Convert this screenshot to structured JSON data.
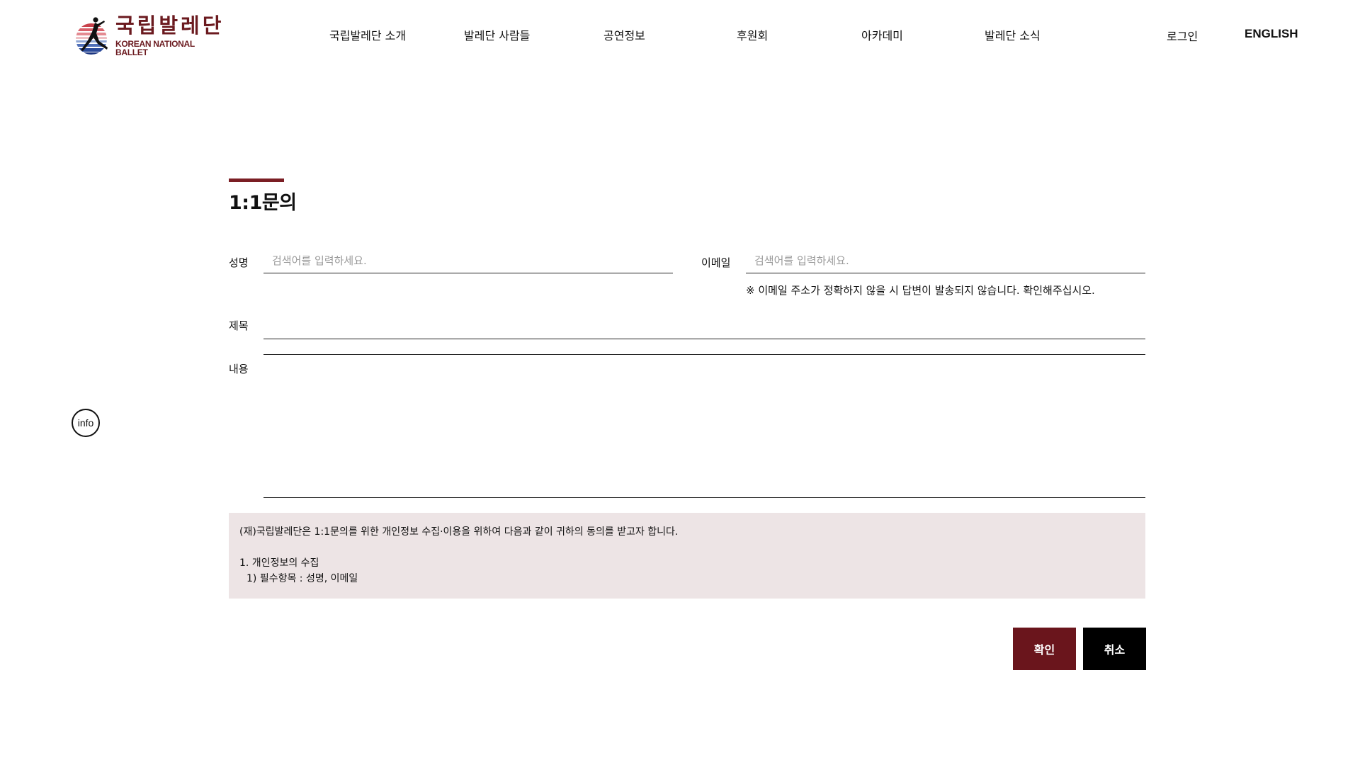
{
  "header": {
    "logo": {
      "ko": "국립발레단",
      "en": "KOREAN NATIONAL BALLET",
      "icon": "ballerina-logo-icon"
    },
    "nav": [
      {
        "label": "국립발레단 소개"
      },
      {
        "label": "발레단 사람들"
      },
      {
        "label": "공연정보"
      },
      {
        "label": "후원회"
      },
      {
        "label": "아카데미"
      },
      {
        "label": "발레단 소식"
      }
    ],
    "login_label": "로그인",
    "language_label": "ENGLISH"
  },
  "side": {
    "info_label": "info"
  },
  "page": {
    "title": "1:1문의"
  },
  "form": {
    "name": {
      "label": "성명",
      "placeholder": "검색어를 입력하세요."
    },
    "email": {
      "label": "이메일",
      "placeholder": "검색어를 입력하세요.",
      "note": "※ 이메일 주소가 정확하지 않을 시 답변이 발송되지 않습니다. 확인해주십시오."
    },
    "subject": {
      "label": "제목"
    },
    "content": {
      "label": "내용"
    }
  },
  "agreement": {
    "intro": "(재)국립발레단은 1:1문의를 위한 개인정보 수집·이용을 위하여 다음과 같이 귀하의 동의를 받고자 합니다.",
    "section1": "1. 개인정보의 수집",
    "item1": "1) 필수항목 : 성명, 이메일"
  },
  "buttons": {
    "confirm": "확인",
    "cancel": "취소"
  },
  "colors": {
    "brand": "#6a151c",
    "accent_bar": "#7b1e24",
    "notice_bg": "#ede4e5"
  }
}
